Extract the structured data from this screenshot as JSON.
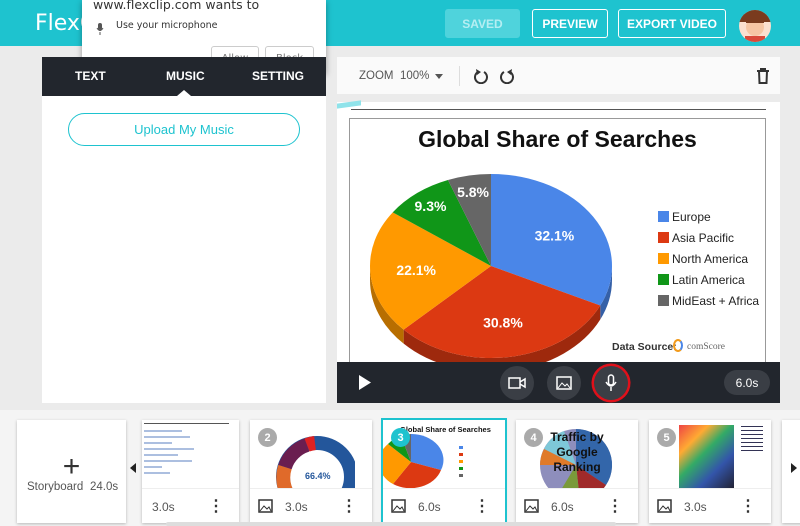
{
  "header": {
    "logo": "FlexC",
    "saved": "SAVED",
    "preview": "PREVIEW",
    "export": "EXPORT VIDEO"
  },
  "popup": {
    "title": "www.flexclip.com wants to",
    "permission": "Use your microphone",
    "allow": "Allow",
    "block": "Block"
  },
  "left_panel": {
    "tabs": [
      {
        "label": "TEXT"
      },
      {
        "label": "MUSIC",
        "active": true
      },
      {
        "label": "SETTING"
      }
    ],
    "upload": "Upload My Music"
  },
  "toolbar": {
    "zoom_label": "ZOOM",
    "zoom_value": "100%"
  },
  "slide": {
    "title": "Global Share of Searches",
    "source_label": "Data Source:",
    "source_brand": "comScore"
  },
  "chart_data": {
    "type": "pie",
    "title": "Global Share of Searches",
    "categories": [
      "Europe",
      "Asia Pacific",
      "North America",
      "Latin America",
      "MidEast + Africa"
    ],
    "values": [
      32.1,
      30.8,
      22.1,
      9.3,
      5.8
    ],
    "labels": [
      "32.1%",
      "30.8%",
      "22.1%",
      "9.3%",
      "5.8%"
    ],
    "colors": [
      "#4a86e8",
      "#dc3912",
      "#ff9900",
      "#109618",
      "#666666"
    ],
    "legend": "right"
  },
  "player": {
    "duration": "6.0s"
  },
  "storyboard": {
    "label": "Storyboard",
    "total": "24.0s",
    "cards": [
      {
        "num": "",
        "duration": "3.0s"
      },
      {
        "num": "2",
        "duration": "3.0s",
        "thumb_text": "66.4%"
      },
      {
        "num": "3",
        "duration": "6.0s",
        "thumb_text": "Global Share of Searches",
        "active": true
      },
      {
        "num": "4",
        "duration": "6.0s",
        "thumb_text": "Traffic by Google Ranking"
      },
      {
        "num": "5",
        "duration": "3.0s"
      }
    ]
  },
  "colors": {
    "brand": "#1ec3cf",
    "highlight": "#e0101a"
  }
}
